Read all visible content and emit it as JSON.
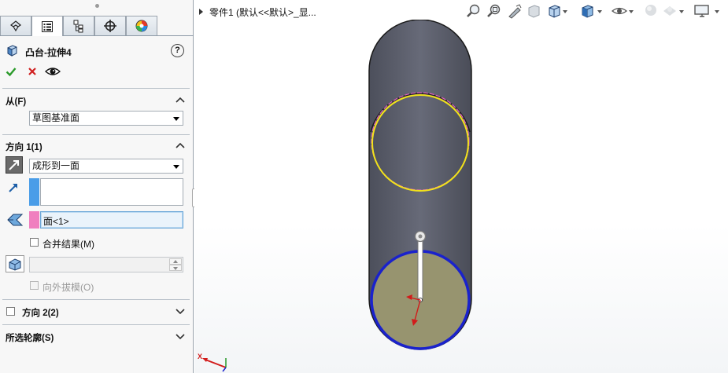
{
  "feature": {
    "title": "凸台-拉伸4"
  },
  "from": {
    "section_title": "从(F)",
    "value": "草图基准面"
  },
  "direction1": {
    "section_title": "方向 1(1)",
    "end_condition": "成形到一面",
    "face_value": "面<1>",
    "merge_label": "合并结果(M)",
    "merge_checked": false,
    "draft_label": "向外拔模(O)"
  },
  "direction2": {
    "section_title": "方向 2(2)"
  },
  "contours": {
    "section_title": "所选轮廓(S)"
  },
  "viewport": {
    "breadcrumb": "零件1  (默认<<默认>_显..."
  },
  "triad": {
    "x_label": "X"
  },
  "colors": {
    "accept": "#2a9a2a",
    "cancel": "#d02020",
    "body": "#5e6270",
    "end_face": "#97946f",
    "edge_blue": "#1a22cc",
    "sketch_yellow": "#f2e21a",
    "sketch_pink": "#e060c0",
    "swatch_blue": "#4a9de8",
    "swatch_pink": "#f07fbf"
  }
}
